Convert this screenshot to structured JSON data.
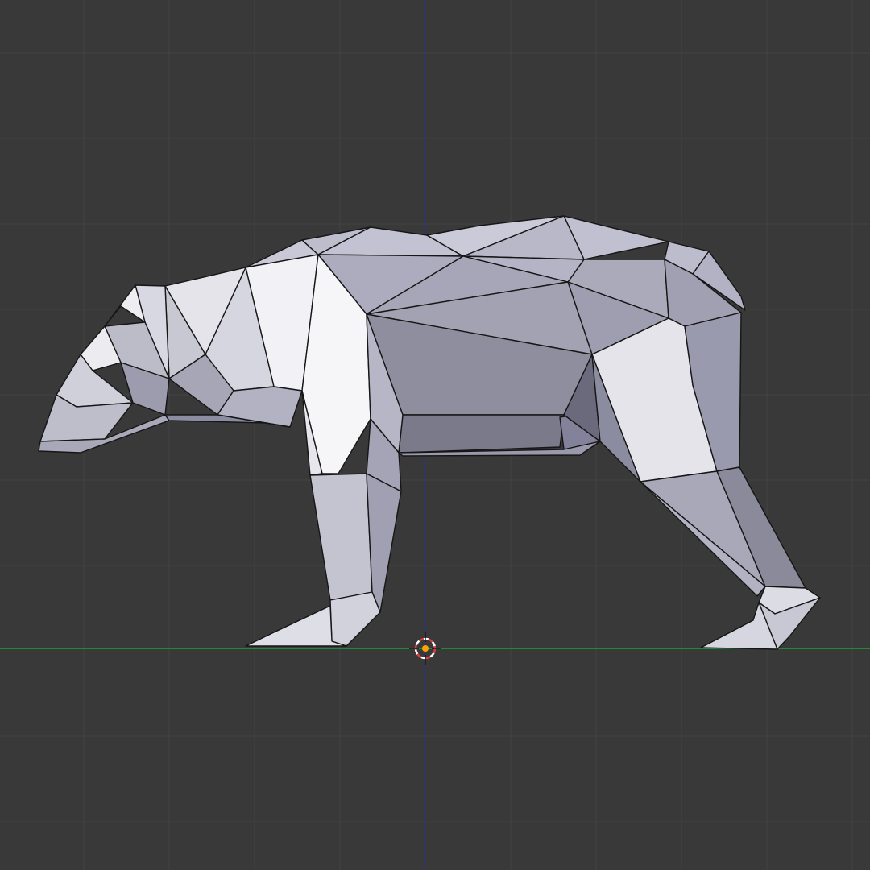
{
  "viewport": {
    "background": "#393939",
    "grid_color": "#434343",
    "view": "side-orthographic"
  },
  "axes": {
    "x_axis_color": "#1e8b3a",
    "z_axis_color": "#2d2f8f"
  },
  "cursor_3d": {
    "ring_color_a": "#e23b3b",
    "ring_color_b": "#ffffff",
    "center_color": "#ffa200"
  },
  "object": {
    "kind": "low-poly bear mesh",
    "shading": "solid",
    "base_color": "#b8b8c6",
    "edge_color": "#161616"
  }
}
